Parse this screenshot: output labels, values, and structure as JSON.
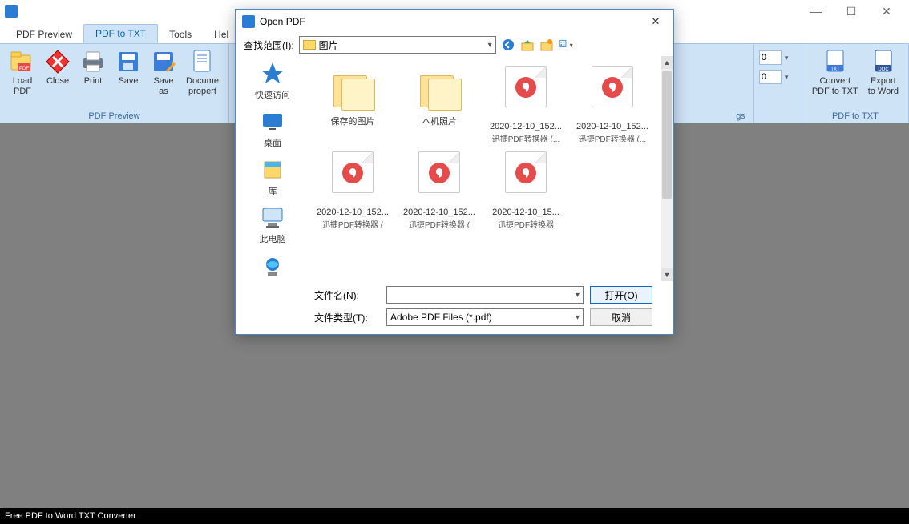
{
  "app": {
    "status": "Free PDF to Word TXT Converter"
  },
  "tabs": {
    "preview": "PDF Preview",
    "totxt": "PDF to TXT",
    "tools": "Tools",
    "help": "Hel"
  },
  "ribbon": {
    "group_preview": "PDF Preview",
    "group_settings_suffix": "gs",
    "group_txt": "PDF to TXT",
    "load": "Load\nPDF",
    "close": "Close",
    "print": "Print",
    "save": "Save",
    "saveas": "Save\nas",
    "docprop": "Docume\npropert",
    "num_a": "0",
    "num_b": "0",
    "convert": "Convert\nPDF to TXT",
    "export": "Export\nto Word"
  },
  "dialog": {
    "title": "Open PDF",
    "lookin_label": "查找范围(I):",
    "lookin_value": "图片",
    "files": [
      {
        "kind": "folder",
        "name": "保存的图片",
        "sub": ""
      },
      {
        "kind": "folder",
        "name": "本机照片",
        "sub": ""
      },
      {
        "kind": "pdf",
        "name": "2020-12-10_152...",
        "sub": "迅捷PDF转换器 (..."
      },
      {
        "kind": "pdf",
        "name": "2020-12-10_152...",
        "sub": "迅捷PDF转换器 (..."
      },
      {
        "kind": "pdf",
        "name": "2020-12-10_152...",
        "sub": "迅捷PDF转换器 ("
      },
      {
        "kind": "pdf",
        "name": "2020-12-10_152...",
        "sub": "迅捷PDF转换器 ("
      },
      {
        "kind": "pdf",
        "name": "2020-12-10_15...",
        "sub": "迅捷PDF转换器"
      }
    ],
    "places": {
      "quick": "快速访问",
      "desktop": "桌面",
      "libs": "库",
      "thispc": "此电脑",
      "network": "网络"
    },
    "filename_label": "文件名(N):",
    "filename_value": "",
    "filetype_label": "文件类型(T):",
    "filetype_value": "Adobe PDF Files (*.pdf)",
    "open_btn": "打开(O)",
    "cancel_btn": "取消"
  }
}
